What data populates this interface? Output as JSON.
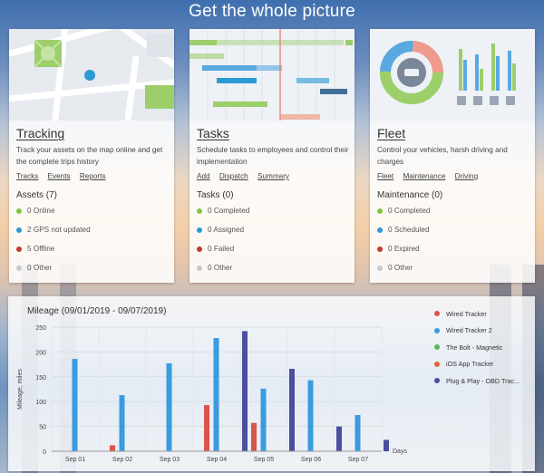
{
  "hero": {
    "title": "Get the whole picture"
  },
  "cards": [
    {
      "title": "Tracking",
      "description": "Track your assets on the map online and get the complete trips history",
      "links": [
        "Tracks",
        "Events",
        "Reports"
      ],
      "section": "Assets (7)",
      "stats": [
        {
          "label": "0 Online",
          "color": "#86c43f"
        },
        {
          "label": "2 GPS not updated",
          "color": "#2a9bd4"
        },
        {
          "label": "5 Offline",
          "color": "#c0392b"
        },
        {
          "label": "0 Other",
          "color": "#c8c8c8"
        }
      ]
    },
    {
      "title": "Tasks",
      "description": "Schedule tasks to employees and control their implementation",
      "links": [
        "Add",
        "Dispatch",
        "Summary"
      ],
      "section": "Tasks (0)",
      "stats": [
        {
          "label": "0 Completed",
          "color": "#86c43f"
        },
        {
          "label": "0 Assigned",
          "color": "#2a9bd4"
        },
        {
          "label": "0 Failed",
          "color": "#c0392b"
        },
        {
          "label": "0 Other",
          "color": "#c8c8c8"
        }
      ]
    },
    {
      "title": "Fleet",
      "description": "Control your vehicles, harsh driving and charges",
      "links": [
        "Fleet",
        "Maintenance",
        "Driving"
      ],
      "section": "Maintenance (0)",
      "stats": [
        {
          "label": "0 Completed",
          "color": "#86c43f"
        },
        {
          "label": "0 Scheduled",
          "color": "#2a9bd4"
        },
        {
          "label": "0 Expired",
          "color": "#c0392b"
        },
        {
          "label": "0 Other",
          "color": "#c8c8c8"
        }
      ]
    }
  ],
  "chart_data": {
    "type": "bar",
    "title": "Mileage (09/01/2019 - 09/07/2019)",
    "xlabel": "Days",
    "ylabel": "Mileage, miles",
    "ylim": [
      0,
      250
    ],
    "yticks": [
      0,
      50,
      100,
      150,
      200,
      250
    ],
    "categories": [
      "Sep 01",
      "Sep 02",
      "Sep 03",
      "Sep 04",
      "Sep 05",
      "Sep 06",
      "Sep 07"
    ],
    "grid": true,
    "legend_position": "right",
    "series": [
      {
        "name": "Wired Tracker",
        "color": "#d9534f",
        "values": [
          0,
          12,
          0,
          93,
          57,
          0,
          0
        ]
      },
      {
        "name": "Wired Tracker 2",
        "color": "#3a9be0",
        "values": [
          186,
          113,
          177,
          228,
          126,
          143,
          73
        ]
      },
      {
        "name": "The Bolt - Magnetic",
        "color": "#5cb85c",
        "values": [
          0,
          0,
          0,
          0,
          0,
          0,
          0
        ]
      },
      {
        "name": "iOS App Tracker",
        "color": "#e8623a",
        "values": [
          0,
          0,
          0,
          0,
          0,
          0,
          0
        ]
      },
      {
        "name": "Plug & Play - OBD Trac...",
        "color": "#4a4fa0",
        "values": [
          0,
          0,
          0,
          242,
          166,
          50,
          23
        ]
      }
    ]
  }
}
